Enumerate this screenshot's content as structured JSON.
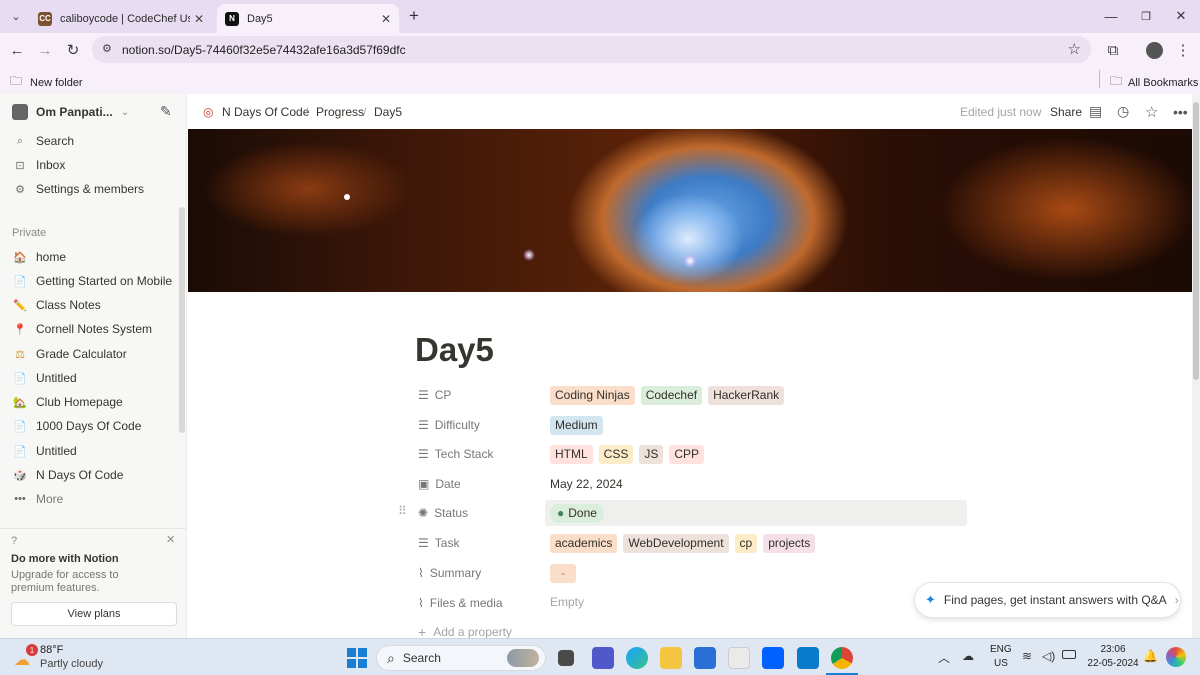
{
  "browser": {
    "tabs": [
      {
        "title": "caliboycode | CodeChef User Pr",
        "icon": "codechef-icon"
      },
      {
        "title": "Day5",
        "icon": "notion-icon"
      }
    ],
    "url": "notion.so/Day5-74460f32e5e74432afe16a3d57f69dfc",
    "bookmarks_folder": "New folder",
    "all_bookmarks": "All Bookmarks"
  },
  "sidebar": {
    "workspace": "Om Panpati...",
    "top_items": [
      "Search",
      "Inbox",
      "Settings & members"
    ],
    "section_label": "Private",
    "pages": [
      {
        "label": "home",
        "icon": "🏠"
      },
      {
        "label": "Getting Started on Mobile",
        "icon": "📄"
      },
      {
        "label": "Class Notes",
        "icon": "✏️"
      },
      {
        "label": "Cornell Notes System",
        "icon": "📍"
      },
      {
        "label": "Grade Calculator",
        "icon": "⚖"
      },
      {
        "label": "Untitled",
        "icon": "📄"
      },
      {
        "label": "Club Homepage",
        "icon": "🏡"
      },
      {
        "label": "1000 Days Of Code",
        "icon": "📄"
      },
      {
        "label": "Untitled",
        "icon": "📄"
      },
      {
        "label": "N Days Of Code",
        "icon": "🎲"
      }
    ],
    "more": "More",
    "promo": {
      "title": "Do more with Notion",
      "body": "Upgrade for access to premium features.",
      "button": "View plans"
    }
  },
  "header": {
    "breadcrumbs": [
      "N Days Of Code",
      "Progress",
      "Day5"
    ],
    "edited": "Edited just now",
    "share": "Share"
  },
  "page": {
    "title": "Day5",
    "properties": [
      {
        "name": "CP",
        "tags": [
          {
            "text": "Coding Ninjas",
            "color": "#fadec9"
          },
          {
            "text": "Codechef",
            "color": "#dbeddb"
          },
          {
            "text": "HackerRank",
            "color": "#eee0da"
          }
        ]
      },
      {
        "name": "Difficulty",
        "tags": [
          {
            "text": "Medium",
            "color": "#d3e5ef"
          }
        ]
      },
      {
        "name": "Tech Stack",
        "tags": [
          {
            "text": "HTML",
            "color": "#ffe2dd"
          },
          {
            "text": "CSS",
            "color": "#fdecc8"
          },
          {
            "text": "JS",
            "color": "#eee0da"
          },
          {
            "text": "CPP",
            "color": "#ffe2dd"
          }
        ]
      },
      {
        "name": "Date",
        "value": "May 22, 2024"
      },
      {
        "name": "Status",
        "status": "Done"
      },
      {
        "name": "Task",
        "tags": [
          {
            "text": "academics",
            "color": "#fadec9"
          },
          {
            "text": "WebDevelopment",
            "color": "#eee0da"
          },
          {
            "text": "cp",
            "color": "#fdecc8"
          },
          {
            "text": "projects",
            "color": "#f5e0e9"
          }
        ]
      },
      {
        "name": "Summary",
        "tags": [
          {
            "text": "-",
            "color": "#fadec9"
          }
        ]
      },
      {
        "name": "Files & media",
        "value": "Empty"
      }
    ],
    "add_property": "Add a property",
    "qa_prompt": "Find pages, get instant answers with Q&A"
  },
  "taskbar": {
    "weather_temp": "88°F",
    "weather_desc": "Partly cloudy",
    "weather_badge": "1",
    "search": "Search",
    "lang1": "ENG",
    "lang2": "US",
    "time": "23:06",
    "date": "22-05-2024"
  }
}
